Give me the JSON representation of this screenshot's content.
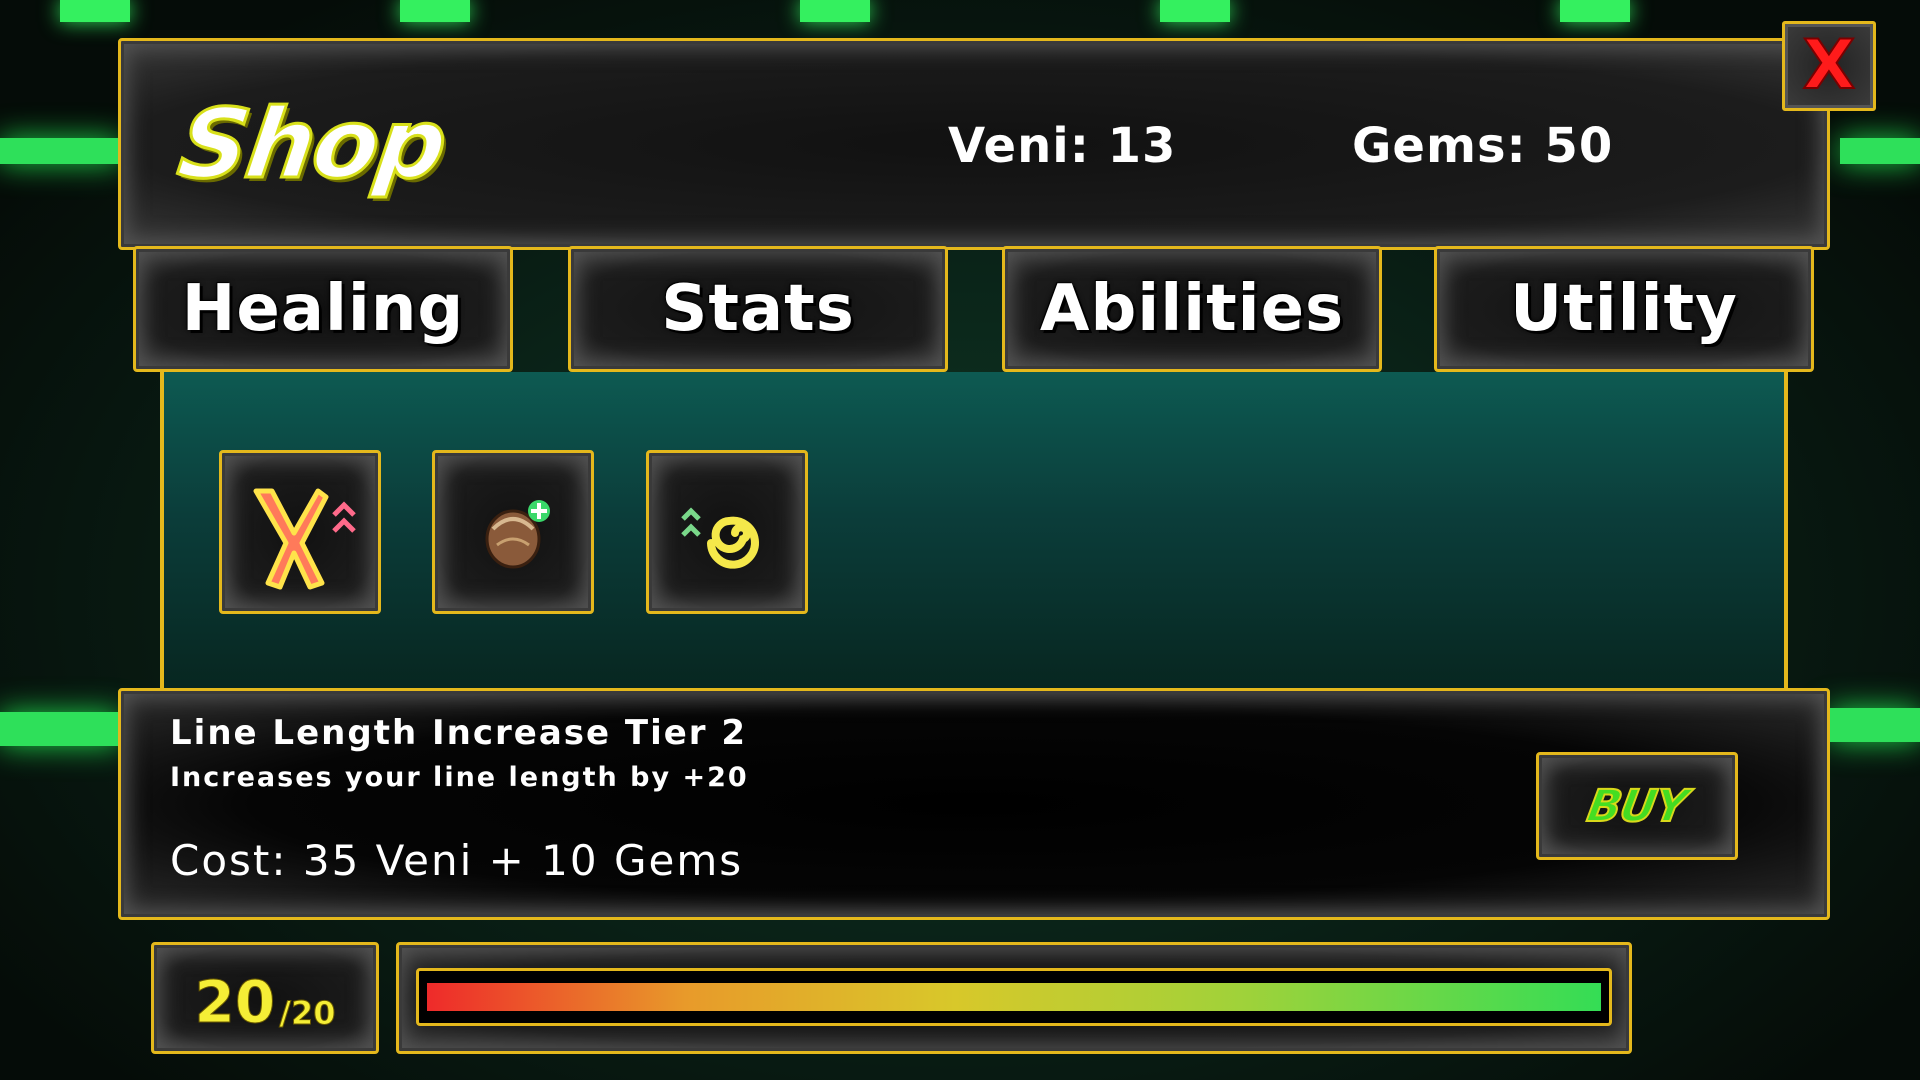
{
  "header": {
    "title": "Shop",
    "veni_label": "Veni: 13",
    "gems_label": "Gems: 50",
    "close_label": "X"
  },
  "tabs": [
    {
      "label": "Healing"
    },
    {
      "label": "Stats"
    },
    {
      "label": "Abilities"
    },
    {
      "label": "Utility"
    }
  ],
  "shop_items": [
    {
      "icon": "line-length-increase-icon"
    },
    {
      "icon": "seed-health-icon"
    },
    {
      "icon": "spiral-upgrade-icon"
    }
  ],
  "selected_item": {
    "name": "Line Length Increase Tier 2",
    "description": "Increases your line length by +20",
    "cost": "Cost: 35 Veni + 10 Gems",
    "buy_label": "BUY"
  },
  "line_length": {
    "current": "20",
    "max": "/20",
    "fill_fraction": 1.0
  },
  "colors": {
    "accent_gold": "#e4b81c",
    "close_red": "#ff1b1b",
    "buy_green": "#44dd22",
    "counter_yellow": "#f5ee36"
  }
}
